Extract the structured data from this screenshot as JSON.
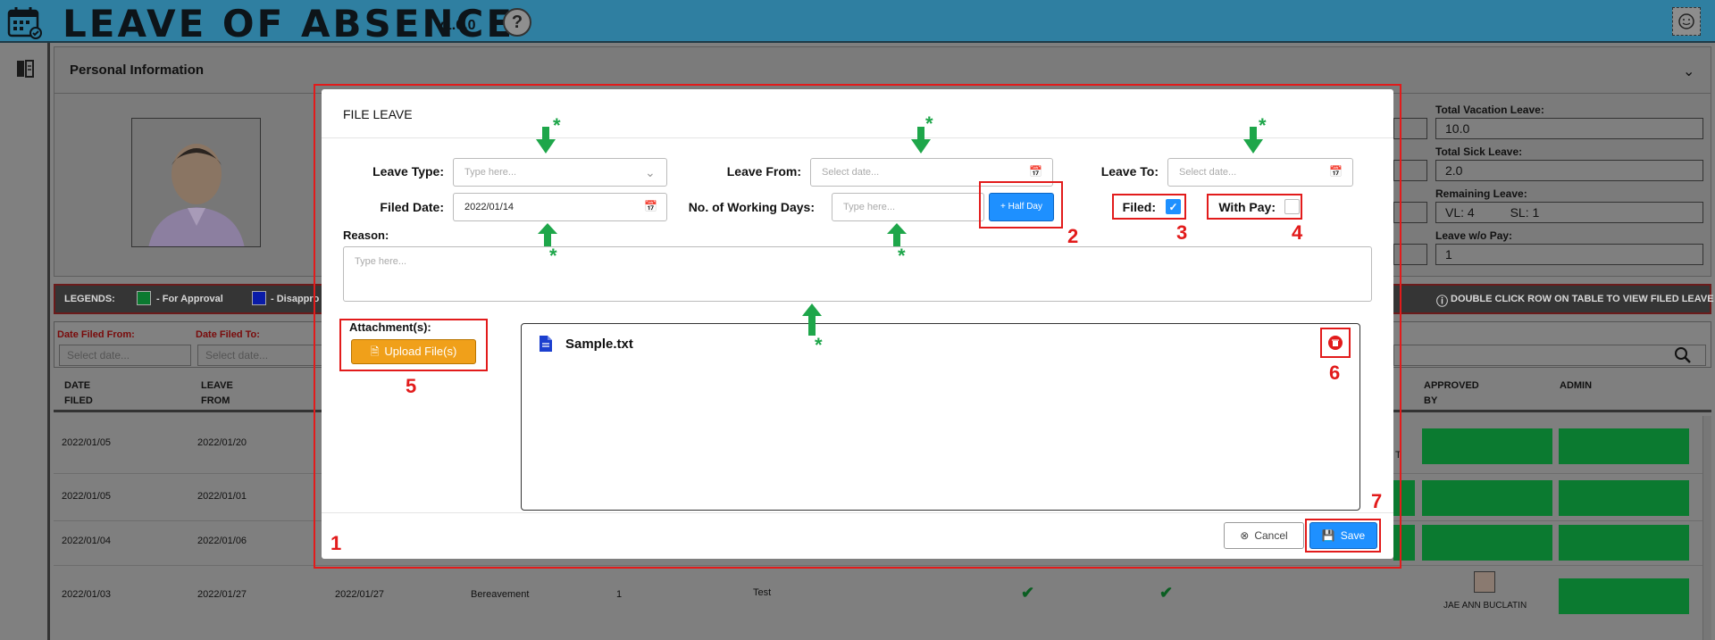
{
  "header": {
    "title": "LEAVE OF ABSENCE",
    "version": "v1.0.0",
    "help_label": "?"
  },
  "personal_info": {
    "title": "Personal Information",
    "fields": [
      {
        "label": "Total Vacation Leave:",
        "value": "10.0"
      },
      {
        "label": "Total Sick Leave:",
        "value": "2.0"
      },
      {
        "label": "Remaining Leave:",
        "value_vl": "VL: 4",
        "value_sl": "SL: 1"
      },
      {
        "label": "Leave w/o Pay:",
        "value": "1"
      }
    ]
  },
  "legend": {
    "title": "LEGENDS:",
    "items": [
      {
        "label": "- For Approval",
        "color": "#0b7a30"
      },
      {
        "label": "- Disappro",
        "color": "#0a1ca8"
      }
    ],
    "hint": "DOUBLE CLICK ROW ON TABLE TO VIEW FILED LEAVE"
  },
  "filters": {
    "date_filed_from_label": "Date Filed From:",
    "date_filed_to_label": "Date Filed To:",
    "placeholder": "Select date..."
  },
  "table": {
    "headers": {
      "date_filed_1": "DATE",
      "date_filed_2": "FILED",
      "leave_from_1": "LEAVE",
      "leave_from_2": "FROM",
      "approved_1": "APPROVED",
      "approved_2": "BY",
      "admin": "ADMIN"
    },
    "rows": [
      {
        "filed": "2022/01/05",
        "from": "2022/01/20"
      },
      {
        "filed": "2022/01/05",
        "from": "2022/01/01"
      },
      {
        "filed": "2022/01/04",
        "from": "2022/01/06"
      },
      {
        "filed": "2022/01/03",
        "from": "2022/01/27",
        "to": "2022/01/27",
        "type": "Bereavement",
        "days": "1",
        "reason": "Test",
        "approver": "JAE ANN BUCLATIN"
      }
    ],
    "partial_letter": "T"
  },
  "modal": {
    "title": "FILE LEAVE",
    "leave_type_label": "Leave Type:",
    "leave_type_placeholder": "Type here...",
    "leave_from_label": "Leave From:",
    "leave_to_label": "Leave To:",
    "date_placeholder": "Select date...",
    "filed_date_label": "Filed Date:",
    "filed_date_value": "2022/01/14",
    "working_days_label": "No. of Working Days:",
    "working_days_placeholder": "Type here...",
    "half_day_label": "+ Half Day",
    "filed_label": "Filed:",
    "filed_checked": true,
    "with_pay_label": "With Pay:",
    "with_pay_checked": false,
    "reason_label": "Reason:",
    "reason_placeholder": "Type here...",
    "attachments_label": "Attachment(s):",
    "upload_label": "Upload File(s)",
    "file_name": "Sample.txt",
    "cancel_label": "Cancel",
    "save_label": "Save"
  },
  "annotations": {
    "numbers": [
      "1",
      "2",
      "3",
      "4",
      "5",
      "6",
      "7"
    ],
    "star": "*",
    "red": "#e21b1b",
    "green": "#1ea64a"
  }
}
